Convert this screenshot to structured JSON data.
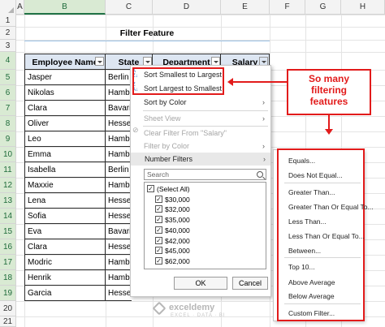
{
  "columns": [
    "A",
    "B",
    "C",
    "D",
    "E",
    "F",
    "G",
    "H"
  ],
  "rows": [
    "1",
    "2",
    "3",
    "4",
    "5",
    "6",
    "7",
    "8",
    "9",
    "10",
    "11",
    "12",
    "13",
    "14",
    "15",
    "16",
    "17",
    "18",
    "19",
    "20",
    "21"
  ],
  "title": "Filter Feature",
  "table": {
    "headers": [
      "Employee Name",
      "State",
      "Department",
      "Salary"
    ],
    "names": [
      "Jasper",
      "Nikolas",
      "Clara",
      "Oliver",
      "Leo",
      "Emma",
      "Isabella",
      "Maxxie",
      "Lena",
      "Sofia",
      "Eva",
      "Clara",
      "Modric",
      "Henrik",
      "Garcia"
    ],
    "states": [
      "Berlin",
      "Hambu",
      "Bavaria",
      "Hesser",
      "Hambu",
      "Hambu",
      "Berlin",
      "Hambu",
      "Hesser",
      "Hesser",
      "Bavaria",
      "Hesser",
      "Hambu",
      "Hambu",
      "Hesser"
    ]
  },
  "menu": {
    "sort_asc": "Sort Smallest to Largest",
    "sort_desc": "Sort Largest to Smallest",
    "sort_color": "Sort by Color",
    "sheet_view": "Sheet View",
    "clear_filter": "Clear Filter From \"Salary\"",
    "filter_color": "Filter by Color",
    "number_filters": "Number Filters",
    "search_placeholder": "Search",
    "items": [
      "(Select All)",
      "$30,000",
      "$32,000",
      "$35,000",
      "$40,000",
      "$42,000",
      "$45,000",
      "$62,000"
    ],
    "ok": "OK",
    "cancel": "Cancel"
  },
  "callout": [
    "So many",
    "filtering",
    "features"
  ],
  "submenu": [
    "Equals...",
    "Does Not Equal...",
    "Greater Than...",
    "Greater Than Or Equal To...",
    "Less Than...",
    "Less Than Or Equal To...",
    "Between...",
    "Top 10...",
    "Above Average",
    "Below Average",
    "Custom Filter..."
  ],
  "watermark": {
    "name": "exceldemy",
    "tagline": "EXCEL · DATA · BI"
  },
  "colors": {
    "accent_red": "#e21b1b",
    "header_fill": "#dde6f2",
    "excel_green": "#217346"
  }
}
